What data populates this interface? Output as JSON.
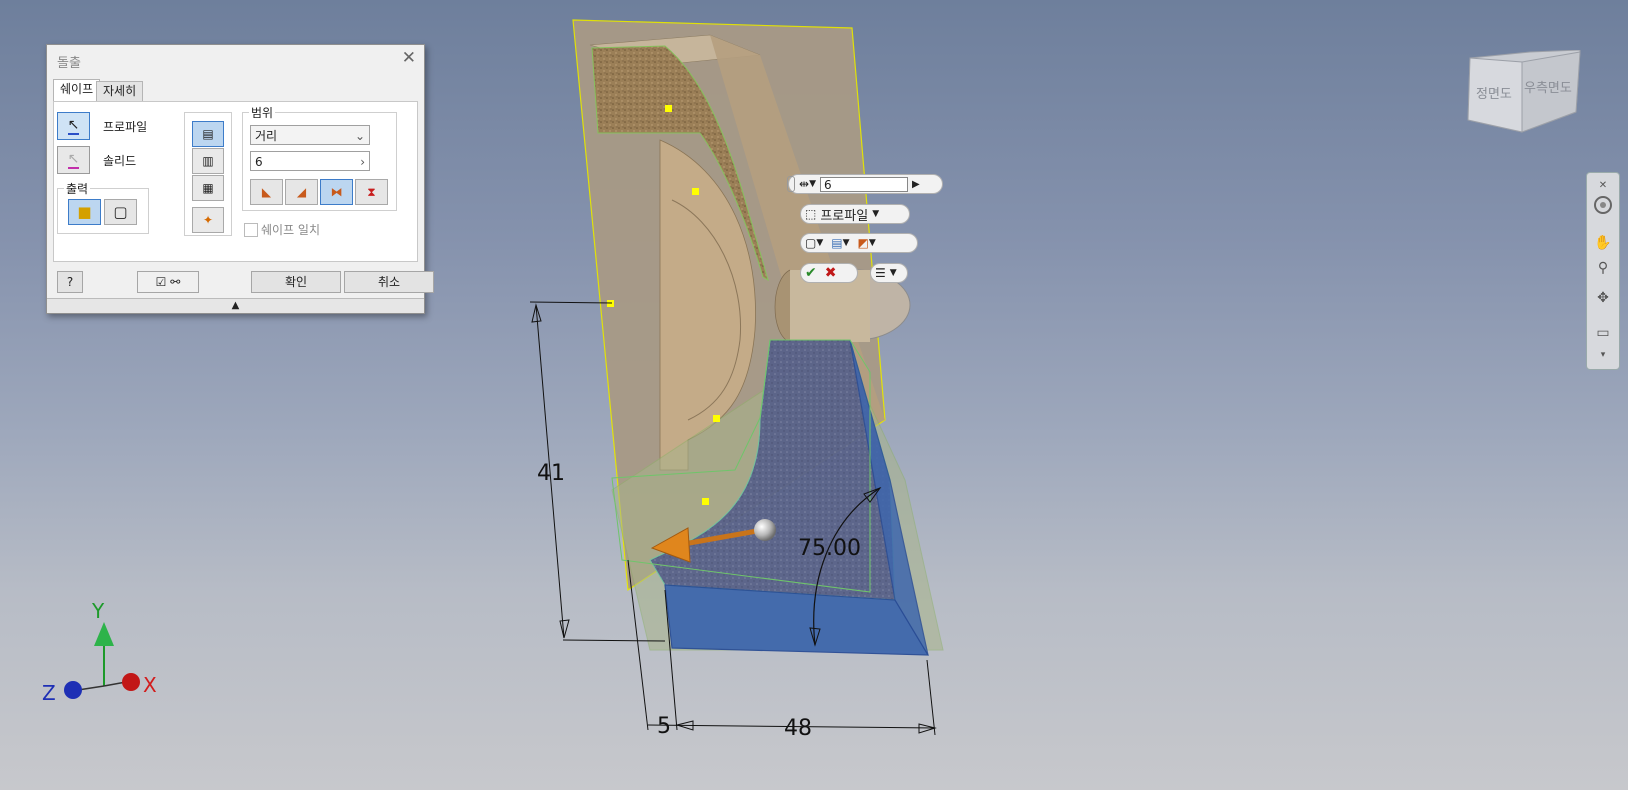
{
  "dialog": {
    "title": "돌출",
    "tabs": [
      {
        "label": "쉐이프"
      },
      {
        "label": "자세히"
      }
    ],
    "profile_label": "프로파일",
    "solid_label": "솔리드",
    "output_label": "출력",
    "extent_label": "범위",
    "extent_type": "거리",
    "distance_value": "6",
    "match_shape_label": "쉐이프 일치",
    "ok_label": "확인",
    "cancel_label": "취소"
  },
  "mini_toolbar": {
    "distance_value": "6",
    "profile_label": "프로파일"
  },
  "viewcube": {
    "front_label": "정면도",
    "right_label": "우측면도"
  },
  "dimensions": {
    "height": "41",
    "left_offset": "5",
    "width": "48",
    "angle": "75.00"
  },
  "axes": {
    "x_label": "X",
    "y_label": "Y",
    "z_label": "Z"
  },
  "colors": {
    "part_body": "#b9a48a",
    "section_fill": "#9a7c55",
    "blue_face": "#3f67ad",
    "preview_green": "#a8b48a",
    "arrow": "#e0861d"
  }
}
